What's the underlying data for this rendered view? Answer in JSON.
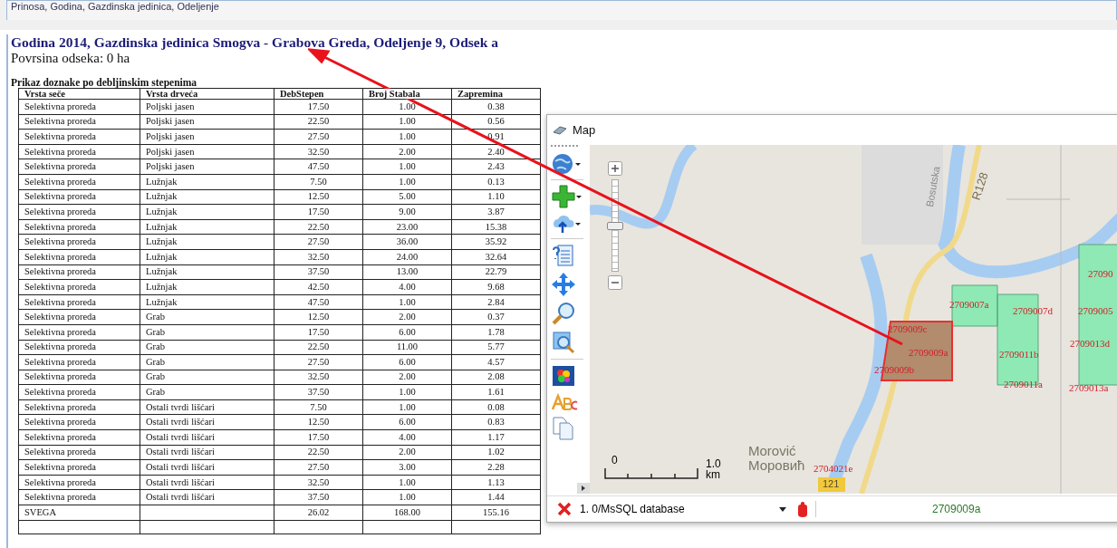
{
  "top_field": {
    "value": "Prinosa, Godina, Gazdinska jedinica, Odeljenje"
  },
  "report": {
    "title": "Godina 2014, Gazdinska jedinica Smogva - Grabova Greda, Odeljenje 9, Odsek a",
    "area": "Povrsina odseka: 0 ha",
    "table_caption": "Prikaz doznake po debljinskim stepenima",
    "table": {
      "columns": [
        "Vrsta seče",
        "Vrsta drveća",
        "DebStepen",
        "Broj Stabala",
        "Zapremina"
      ],
      "rows": [
        [
          "Selektivna proreda",
          "Poljski jasen",
          "17.50",
          "1.00",
          "0.38"
        ],
        [
          "Selektivna proreda",
          "Poljski jasen",
          "22.50",
          "1.00",
          "0.56"
        ],
        [
          "Selektivna proreda",
          "Poljski jasen",
          "27.50",
          "1.00",
          "0.91"
        ],
        [
          "Selektivna proreda",
          "Poljski jasen",
          "32.50",
          "2.00",
          "2.40"
        ],
        [
          "Selektivna proreda",
          "Poljski jasen",
          "47.50",
          "1.00",
          "2.43"
        ],
        [
          "Selektivna proreda",
          "Lužnjak",
          "7.50",
          "1.00",
          "0.13"
        ],
        [
          "Selektivna proreda",
          "Lužnjak",
          "12.50",
          "5.00",
          "1.10"
        ],
        [
          "Selektivna proreda",
          "Lužnjak",
          "17.50",
          "9.00",
          "3.87"
        ],
        [
          "Selektivna proreda",
          "Lužnjak",
          "22.50",
          "23.00",
          "15.38"
        ],
        [
          "Selektivna proreda",
          "Lužnjak",
          "27.50",
          "36.00",
          "35.92"
        ],
        [
          "Selektivna proreda",
          "Lužnjak",
          "32.50",
          "24.00",
          "32.64"
        ],
        [
          "Selektivna proreda",
          "Lužnjak",
          "37.50",
          "13.00",
          "22.79"
        ],
        [
          "Selektivna proreda",
          "Lužnjak",
          "42.50",
          "4.00",
          "9.68"
        ],
        [
          "Selektivna proreda",
          "Lužnjak",
          "47.50",
          "1.00",
          "2.84"
        ],
        [
          "Selektivna proreda",
          "Grab",
          "12.50",
          "2.00",
          "0.37"
        ],
        [
          "Selektivna proreda",
          "Grab",
          "17.50",
          "6.00",
          "1.78"
        ],
        [
          "Selektivna proreda",
          "Grab",
          "22.50",
          "11.00",
          "5.77"
        ],
        [
          "Selektivna proreda",
          "Grab",
          "27.50",
          "6.00",
          "4.57"
        ],
        [
          "Selektivna proreda",
          "Grab",
          "32.50",
          "2.00",
          "2.08"
        ],
        [
          "Selektivna proreda",
          "Grab",
          "37.50",
          "1.00",
          "1.61"
        ],
        [
          "Selektivna proreda",
          "Ostali tvrdi lišćari",
          "7.50",
          "1.00",
          "0.08"
        ],
        [
          "Selektivna proreda",
          "Ostali tvrdi lišćari",
          "12.50",
          "6.00",
          "0.83"
        ],
        [
          "Selektivna proreda",
          "Ostali tvrdi lišćari",
          "17.50",
          "4.00",
          "1.17"
        ],
        [
          "Selektivna proreda",
          "Ostali tvrdi lišćari",
          "22.50",
          "2.00",
          "1.02"
        ],
        [
          "Selektivna proreda",
          "Ostali tvrdi lišćari",
          "27.50",
          "3.00",
          "2.28"
        ],
        [
          "Selektivna proreda",
          "Ostali tvrdi lišćari",
          "32.50",
          "1.00",
          "1.13"
        ],
        [
          "Selektivna proreda",
          "Ostali tvrdi lišćari",
          "37.50",
          "1.00",
          "1.44"
        ]
      ],
      "total": {
        "label": "SVEGA",
        "values": [
          "26.02",
          "168.00",
          "155.16"
        ]
      }
    }
  },
  "map_window": {
    "title": "Map",
    "map": {
      "street_label": "Bosutska",
      "road_labels": [
        "R128",
        "121"
      ],
      "place_labels": [
        "Morović",
        "Моровић"
      ],
      "zoom": {
        "level": 0.5
      },
      "parcel_labels": [
        "27090",
        "2709007a",
        "2709007d",
        "2709005",
        "2709009c",
        "2709013d",
        "2709009a",
        "2709011b",
        "2709009b",
        "2709011a",
        "2709013a",
        "2704021e"
      ],
      "scale": {
        "start": "0",
        "end": "1.0",
        "unit": "km"
      }
    },
    "layer_select": "1. 0/MsSQL database",
    "selected_feature": "2709009a"
  }
}
